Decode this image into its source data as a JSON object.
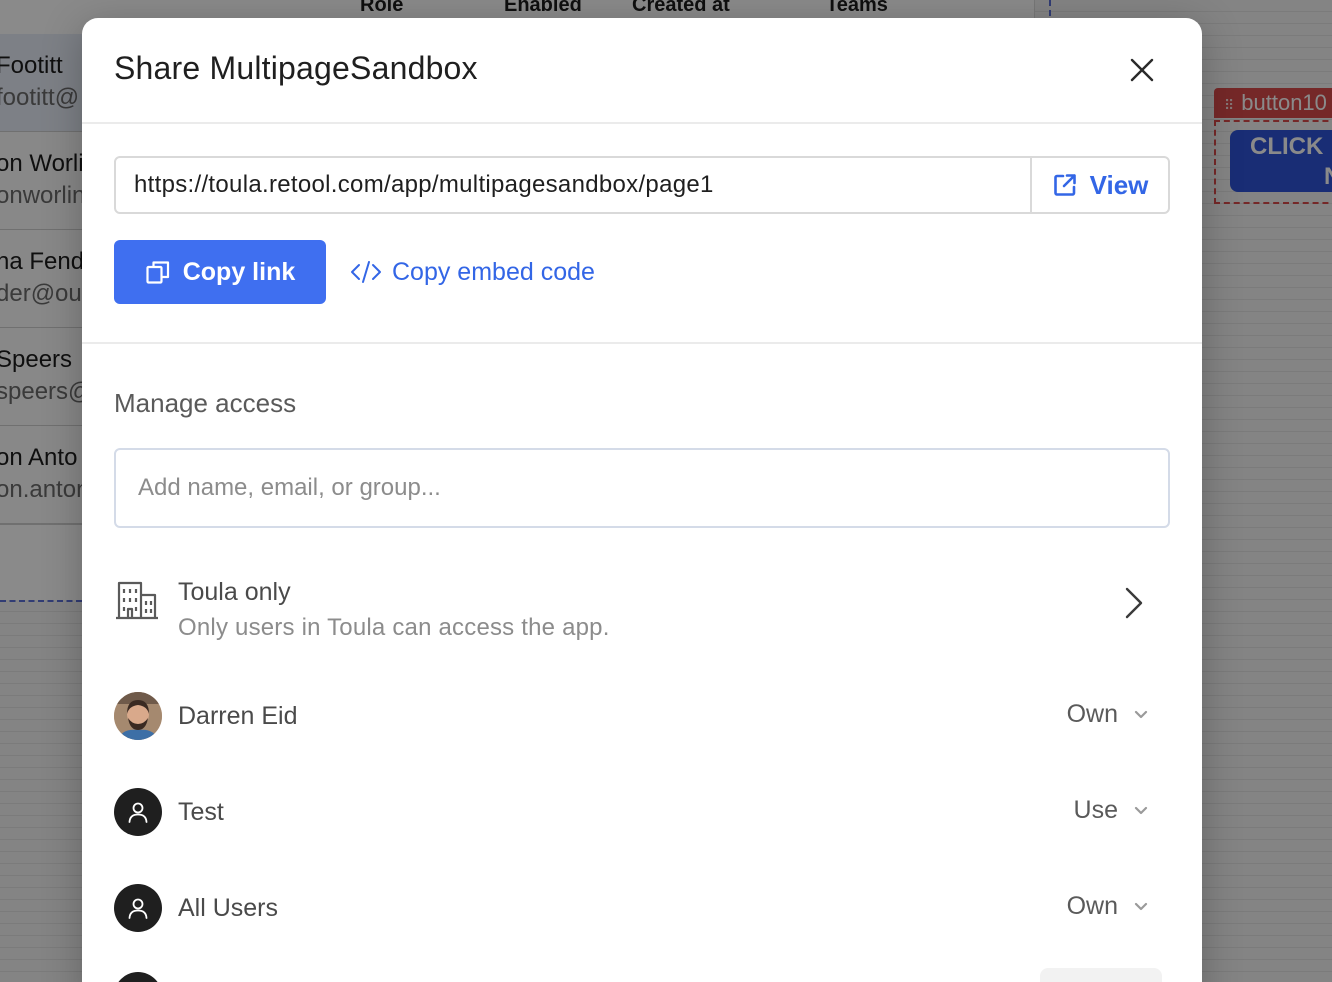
{
  "background": {
    "table_headers": [
      "Role",
      "Enabled",
      "Created at",
      "Teams"
    ],
    "rows": [
      {
        "name": "Footitt",
        "email": "footitt@"
      },
      {
        "name": "on Worli",
        "email": "onworlin"
      },
      {
        "name": "na Fend",
        "email": "der@out"
      },
      {
        "name": "Speers",
        "email": "speers@"
      },
      {
        "name": "on Anto",
        "email": "on.anton"
      }
    ],
    "component_tag": "button10",
    "component_button_text": [
      "CLICK",
      "N"
    ],
    "colors": {
      "component_tag": "#d94b4b",
      "component_button": "#2f54d9"
    }
  },
  "modal": {
    "title": "Share MultipageSandbox",
    "close_icon": "close-icon",
    "url": "https://toula.retool.com/app/multipagesandbox/page1",
    "view_label": "View",
    "copy_link_label": "Copy link",
    "copy_embed_label": "Copy embed code",
    "manage_access_label": "Manage access",
    "add_placeholder": "Add name, email, or group...",
    "org": {
      "title": "Toula only",
      "description": "Only users in Toula can access the app.",
      "icon": "building-icon"
    },
    "members": [
      {
        "name": "Darren Eid",
        "permission": "Own",
        "avatar": "photo"
      },
      {
        "name": "Test",
        "permission": "Use",
        "avatar": "user-icon"
      },
      {
        "name": "All Users",
        "permission": "Own",
        "avatar": "user-icon"
      }
    ],
    "colors": {
      "primary": "#3f6ff0",
      "link": "#3366e6"
    }
  }
}
